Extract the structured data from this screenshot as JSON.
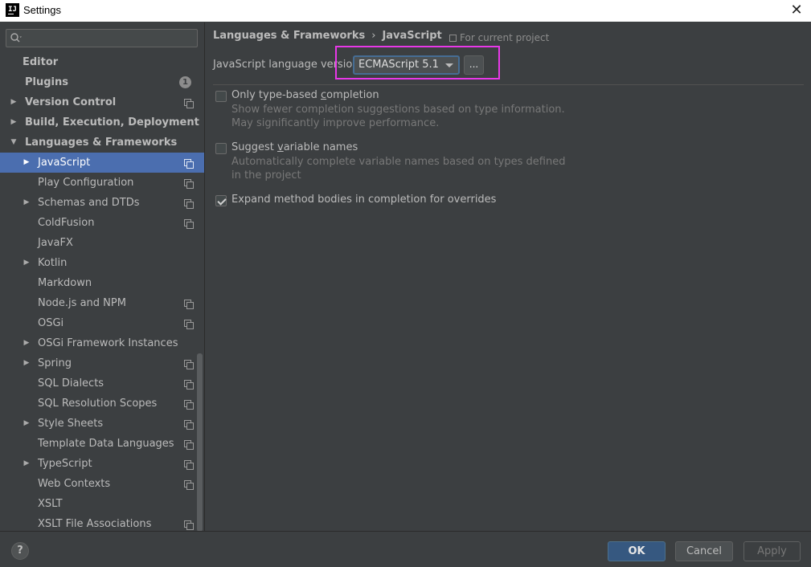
{
  "window": {
    "title": "Settings",
    "icon_text": "IJ",
    "close_glyph": "✕"
  },
  "sidebar": {
    "search": {
      "placeholder": ""
    },
    "items": [
      {
        "label": "Editor",
        "level": 0,
        "bold": true,
        "arrow": "",
        "project": false
      },
      {
        "label": "Plugins",
        "level": 0,
        "bold": true,
        "arrow": "",
        "project": false,
        "badge": "1"
      },
      {
        "label": "Version Control",
        "level": 0,
        "bold": true,
        "arrow": "▶",
        "project": true
      },
      {
        "label": "Build, Execution, Deployment",
        "level": 0,
        "bold": true,
        "arrow": "▶",
        "project": false
      },
      {
        "label": "Languages & Frameworks",
        "level": 0,
        "bold": true,
        "arrow": "▼",
        "project": false
      },
      {
        "label": "JavaScript",
        "level": 1,
        "bold": false,
        "arrow": "▶",
        "project": true,
        "selected": true
      },
      {
        "label": "Play Configuration",
        "level": 1,
        "bold": false,
        "arrow": "",
        "project": true
      },
      {
        "label": "Schemas and DTDs",
        "level": 1,
        "bold": false,
        "arrow": "▶",
        "project": true
      },
      {
        "label": "ColdFusion",
        "level": 1,
        "bold": false,
        "arrow": "",
        "project": true
      },
      {
        "label": "JavaFX",
        "level": 1,
        "bold": false,
        "arrow": "",
        "project": false
      },
      {
        "label": "Kotlin",
        "level": 1,
        "bold": false,
        "arrow": "▶",
        "project": false
      },
      {
        "label": "Markdown",
        "level": 1,
        "bold": false,
        "arrow": "",
        "project": false
      },
      {
        "label": "Node.js and NPM",
        "level": 1,
        "bold": false,
        "arrow": "",
        "project": true
      },
      {
        "label": "OSGi",
        "level": 1,
        "bold": false,
        "arrow": "",
        "project": true
      },
      {
        "label": "OSGi Framework Instances",
        "level": 1,
        "bold": false,
        "arrow": "▶",
        "project": false
      },
      {
        "label": "Spring",
        "level": 1,
        "bold": false,
        "arrow": "▶",
        "project": true
      },
      {
        "label": "SQL Dialects",
        "level": 1,
        "bold": false,
        "arrow": "",
        "project": true
      },
      {
        "label": "SQL Resolution Scopes",
        "level": 1,
        "bold": false,
        "arrow": "",
        "project": true
      },
      {
        "label": "Style Sheets",
        "level": 1,
        "bold": false,
        "arrow": "▶",
        "project": true
      },
      {
        "label": "Template Data Languages",
        "level": 1,
        "bold": false,
        "arrow": "",
        "project": true
      },
      {
        "label": "TypeScript",
        "level": 1,
        "bold": false,
        "arrow": "▶",
        "project": true
      },
      {
        "label": "Web Contexts",
        "level": 1,
        "bold": false,
        "arrow": "",
        "project": true
      },
      {
        "label": "XSLT",
        "level": 1,
        "bold": false,
        "arrow": "",
        "project": false
      },
      {
        "label": "XSLT File Associations",
        "level": 1,
        "bold": false,
        "arrow": "",
        "project": true
      }
    ]
  },
  "main": {
    "breadcrumb": {
      "parent": "Languages & Frameworks",
      "separator": "›",
      "current": "JavaScript"
    },
    "scope_note": "For current project",
    "language_version": {
      "label": "JavaScript language version",
      "value": "ECMAScript 5.1",
      "more_label": "..."
    },
    "options": [
      {
        "title_pre": "Only type-based ",
        "title_u": "c",
        "title_post": "ompletion",
        "description": "Show fewer completion suggestions based on type information. May significantly improve performance.",
        "checked": false
      },
      {
        "title_pre": "Suggest ",
        "title_u": "v",
        "title_post": "ariable names",
        "description": "Automatically complete variable names based on types defined in the project",
        "checked": false
      },
      {
        "title_pre": "Expand method bodies in completion for overrides",
        "title_u": "",
        "title_post": "",
        "description": "",
        "checked": true
      }
    ]
  },
  "footer": {
    "help_label": "?",
    "ok_label": "OK",
    "cancel_label": "Cancel",
    "apply_label": "Apply"
  },
  "colors": {
    "background": "#3c3f41",
    "selection": "#4b6eaf",
    "highlight_box": "#e838e8",
    "ok_button": "#365880"
  }
}
